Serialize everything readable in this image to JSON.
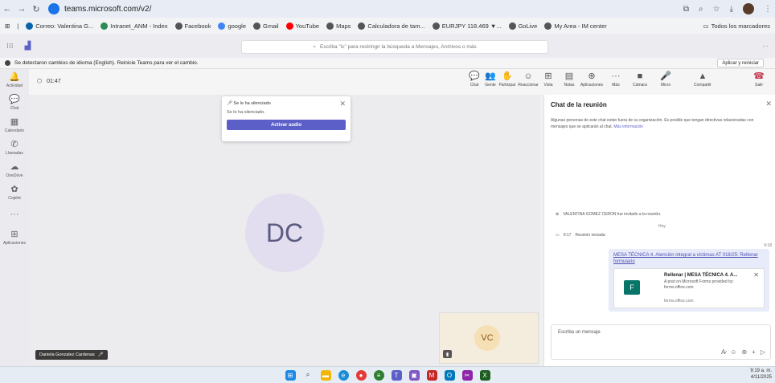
{
  "browser": {
    "url": "teams.microsoft.com/v2/",
    "bookmarks": [
      {
        "label": "Correo: Valentina G...",
        "icon": "outlook-icon",
        "color": "#0a64ad"
      },
      {
        "label": "Intranet_ANM - Index",
        "icon": "intranet-icon",
        "color": "#2e8b57"
      },
      {
        "label": "Facebook",
        "icon": "globe-icon",
        "color": "#555555"
      },
      {
        "label": "google",
        "icon": "google-icon",
        "color": "#4285f4"
      },
      {
        "label": "Gmail",
        "icon": "globe-icon",
        "color": "#555555"
      },
      {
        "label": "YouTube",
        "icon": "youtube-icon",
        "color": "#ff0000"
      },
      {
        "label": "Maps",
        "icon": "globe-icon",
        "color": "#555555"
      },
      {
        "label": "Calculadora de tam...",
        "icon": "globe-icon",
        "color": "#555555"
      },
      {
        "label": "EURJPY 118.469 ▼...",
        "icon": "globe-icon",
        "color": "#555555"
      },
      {
        "label": "GoLive",
        "icon": "globe-icon",
        "color": "#555555"
      },
      {
        "label": "My Area - IM center",
        "icon": "globe-icon",
        "color": "#555555"
      }
    ],
    "all_bookmarks": "Todos los marcadores"
  },
  "teams": {
    "search_placeholder": "Escriba \"ic\" para restringir la búsqueda a Mensajes, Archivos o más",
    "notice": "Se detectaron cambios de idioma (English). Reinicie Teams para ver el cambio.",
    "notice_button": "Aplicar y reiniciar"
  },
  "rail": [
    {
      "label": "Actividad",
      "icon": "bell-icon",
      "glyph": "🔔"
    },
    {
      "label": "Chat",
      "icon": "chat-icon",
      "glyph": "💬"
    },
    {
      "label": "Calendario",
      "icon": "calendar-icon",
      "glyph": "▦"
    },
    {
      "label": "Llamadas",
      "icon": "phone-icon",
      "glyph": "✆"
    },
    {
      "label": "OneDrive",
      "icon": "cloud-icon",
      "glyph": "☁"
    },
    {
      "label": "Copilot",
      "icon": "copilot-icon",
      "glyph": "✿"
    },
    {
      "label": "",
      "icon": "more-icon",
      "glyph": "···"
    },
    {
      "label": "Aplicaciones",
      "icon": "apps-icon",
      "glyph": "⊞"
    }
  ],
  "meeting": {
    "timer": "01:47",
    "tools": [
      {
        "label": "Chat",
        "icon": "chat-icon",
        "glyph": "💬"
      },
      {
        "label": "Gente",
        "icon": "people-icon",
        "glyph": "👥"
      },
      {
        "label": "Participar",
        "icon": "hand-icon",
        "glyph": "✋"
      },
      {
        "label": "Reaccionar",
        "icon": "smile-icon",
        "glyph": "☺"
      },
      {
        "label": "Vista",
        "icon": "grid-icon",
        "glyph": "⊞"
      },
      {
        "label": "Notas",
        "icon": "notes-icon",
        "glyph": "▤"
      },
      {
        "label": "Aplicaciones",
        "icon": "add-icon",
        "glyph": "⊕"
      },
      {
        "label": "Más",
        "icon": "more-icon",
        "glyph": "···"
      },
      {
        "label": "Cámara",
        "icon": "camera-icon",
        "glyph": "■"
      },
      {
        "label": "Micro",
        "icon": "mic-icon",
        "glyph": "🎤"
      },
      {
        "label": "Compartir",
        "icon": "share-icon",
        "glyph": "▲"
      },
      {
        "label": "Salir",
        "icon": "hangup-icon",
        "glyph": "☎"
      }
    ],
    "participant_initials": "DC",
    "participant_name": "Daniela Gonzalez Cardenas",
    "self_initials": "VC",
    "toast": {
      "title": "Se le ha silenciado",
      "body": "Se le ha silenciado.",
      "button": "Activar audio"
    }
  },
  "chat": {
    "title": "Chat de la reunión",
    "note": "Algunas personas de este chat están fuera de su organización. Es posible que tengan directivas relacionadas con mensajes que se aplicarán al chat.",
    "note_link": "Más información",
    "invite_event": "VALENTINA GOMEZ CERON fue invitado a la reunión.",
    "today": "Hoy",
    "started_time": "9:17",
    "started_label": "Reunión iniciada:",
    "message_time": "9:18",
    "message_link": "MESA TÉCNICA 4. Atención integral a víctimas AT 018/25: Rellenar formulario",
    "card_title": "Rellenar | MESA TÉCNICA 4. A...",
    "card_desc": "A post on Microsoft Forms provided by: forms.office.com",
    "card_domain": "forms.office.com",
    "compose_placeholder": "Escriba un mensaje"
  },
  "taskbar": {
    "time": "9:19 a. m.",
    "date": "4/11/2025"
  }
}
